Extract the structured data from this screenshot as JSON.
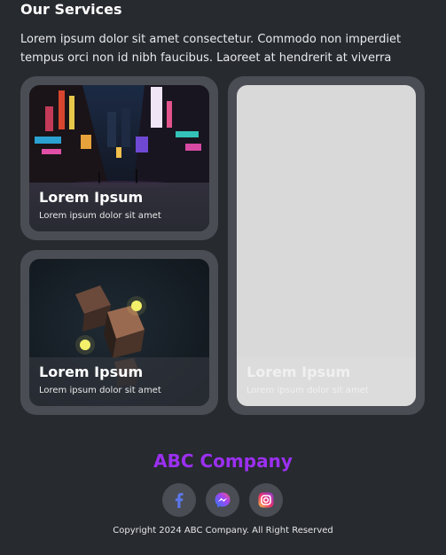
{
  "services": {
    "title": "Our Services",
    "description": "Lorem ipsum dolor sit amet consectetur. Commodo non imperdiet tempus orci non id nibh faucibus. Laoreet at hendrerit at viverra"
  },
  "cards": [
    {
      "title": "Lorem Ipsum",
      "subtitle": "Lorem ipsum dolor sit amet"
    },
    {
      "title": "Lorem Ipsum",
      "subtitle": "Lorem ipsum dolor sit amet"
    },
    {
      "title": "Lorem Ipsum",
      "subtitle": "Lorem ipsum dolor sit amet"
    }
  ],
  "footer": {
    "brand": "ABC Company",
    "copyright": "Copyright 2024 ABC Company. All Right Reserved",
    "socials": [
      {
        "icon": "facebook-icon"
      },
      {
        "icon": "messenger-icon"
      },
      {
        "icon": "instagram-icon"
      }
    ]
  },
  "colors": {
    "background": "#272a2f",
    "brand": "#9b30f0",
    "frame": "#4a4d53"
  }
}
